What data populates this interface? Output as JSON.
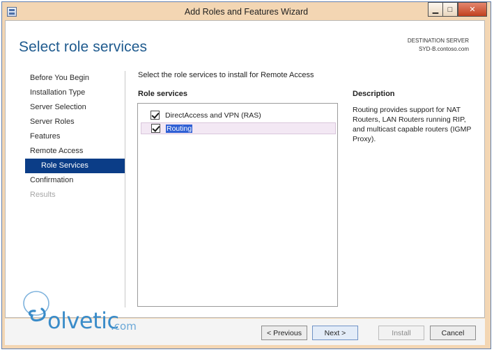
{
  "window": {
    "title": "Add Roles and Features Wizard",
    "controls": {
      "minimize": "▁",
      "maximize": "□",
      "close": "✕"
    }
  },
  "page": {
    "title": "Select role services",
    "destination_label": "DESTINATION SERVER",
    "destination_server": "SYD-B.contoso.com"
  },
  "nav": {
    "items": [
      {
        "label": "Before You Begin",
        "state": "normal"
      },
      {
        "label": "Installation Type",
        "state": "normal"
      },
      {
        "label": "Server Selection",
        "state": "normal"
      },
      {
        "label": "Server Roles",
        "state": "normal"
      },
      {
        "label": "Features",
        "state": "normal"
      },
      {
        "label": "Remote Access",
        "state": "normal"
      },
      {
        "label": "Role Services",
        "state": "active"
      },
      {
        "label": "Confirmation",
        "state": "normal"
      },
      {
        "label": "Results",
        "state": "disabled"
      }
    ]
  },
  "content": {
    "instruction": "Select the role services to install for Remote Access",
    "role_services_header": "Role services",
    "description_header": "Description",
    "role_services": [
      {
        "label": "DirectAccess and VPN (RAS)",
        "checked": true
      },
      {
        "label": "Routing",
        "checked": true,
        "selected": true
      }
    ],
    "description": "Routing provides support for NAT Routers, LAN Routers running RIP, and multicast capable routers (IGMP Proxy)."
  },
  "buttons": {
    "previous": "< Previous",
    "next": "Next >",
    "install": "Install",
    "cancel": "Cancel"
  },
  "watermark": {
    "brand": "olvetic",
    "suffix": ".com"
  },
  "colors": {
    "title_accent": "#1e5a8e",
    "nav_active": "#0b3d87",
    "selection_highlight": "#2f5fd4",
    "window_frame": "#f3d6b3"
  }
}
